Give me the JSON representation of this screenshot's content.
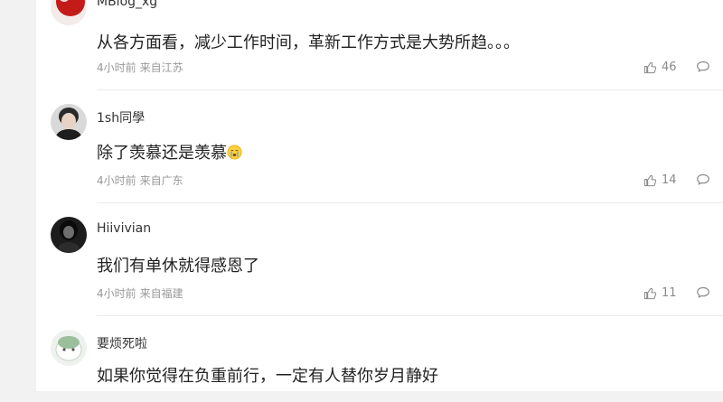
{
  "comments": [
    {
      "username": "MBlog_xg",
      "content": "从各方面看，减少工作时间，革新工作方式是大势所趋。。。",
      "time": "4小时前",
      "location": "来自江苏",
      "likes": "46"
    },
    {
      "username": "1sh同學",
      "content": "除了羡慕还是羡慕",
      "emoji": "crying-face-emoji",
      "time": "4小时前",
      "location": "来自广东",
      "likes": "14"
    },
    {
      "username": "Hiivivian",
      "content": "我们有单休就得感恩了",
      "time": "4小时前",
      "location": "来自福建",
      "likes": "11"
    },
    {
      "username": "要烦死啦",
      "content": "如果你觉得在负重前行，一定有人替你岁月静好"
    }
  ],
  "icons": {
    "like": "thumbs-up-icon",
    "comment": "comment-bubble-icon"
  },
  "colors": {
    "text": "#222222",
    "meta": "#999999",
    "divider": "#ececec",
    "background": "#f2f2f2"
  }
}
